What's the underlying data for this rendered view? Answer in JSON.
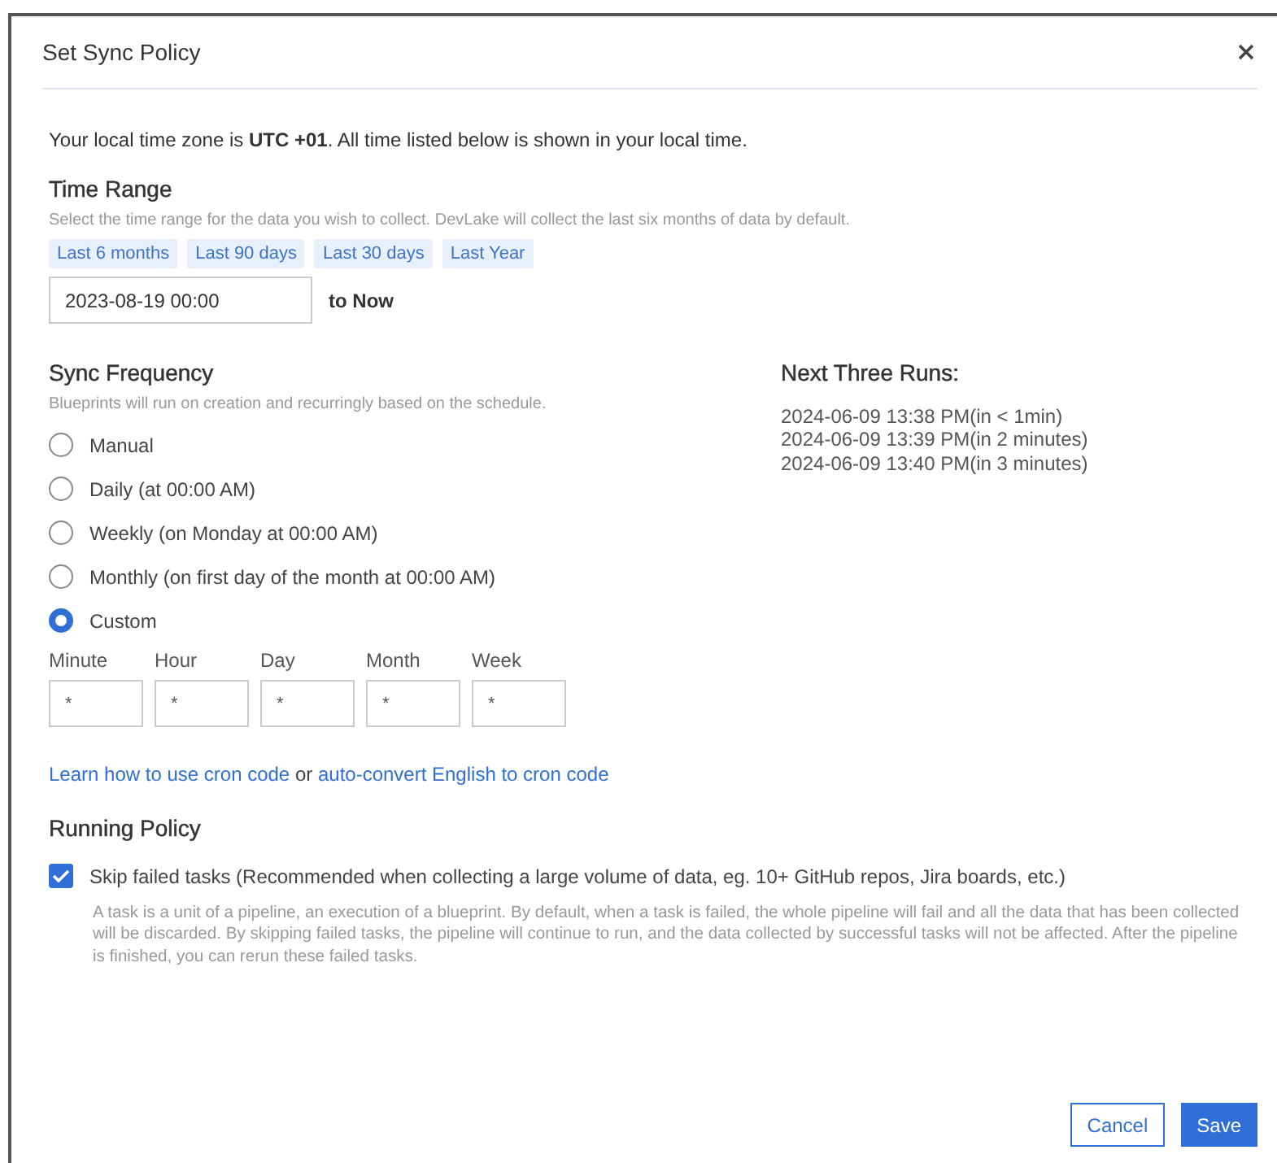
{
  "dialog": {
    "title": "Set Sync Policy",
    "timezone_note": "Your local time zone is **UTC +01**. All time listed below is shown in your local time.",
    "time_range": {
      "heading": "Time Range",
      "description": "Select the time range for the data you wish to collect. DevLake will collect the last six months of data by default.",
      "presets": [
        {
          "label": "Last 6 months"
        },
        {
          "label": "Last 90 days"
        },
        {
          "label": "Last 30 days"
        },
        {
          "label": "Last Year"
        }
      ],
      "start_value": "2023-08-19 00:00",
      "suffix": "to Now"
    },
    "sync_frequency": {
      "heading": "Sync Frequency",
      "description": "Blueprints will run on creation and recurringly based on the schedule.",
      "options": [
        {
          "label": "Manual",
          "selected": false
        },
        {
          "label": "Daily (at 00:00 AM)",
          "selected": false
        },
        {
          "label": "Weekly (on Monday at 00:00 AM)",
          "selected": false
        },
        {
          "label": "Monthly (on first day of the month at 00:00 AM)",
          "selected": false
        },
        {
          "label": "Custom",
          "selected": true
        }
      ],
      "cron_fields": [
        {
          "label": "Minute",
          "value": "*"
        },
        {
          "label": "Hour",
          "value": "*"
        },
        {
          "label": "Day",
          "value": "*"
        },
        {
          "label": "Month",
          "value": "*"
        },
        {
          "label": "Week",
          "value": "*"
        }
      ],
      "help_link": "Learn how to use cron code",
      "help_joiner": "or",
      "convert_link": "auto-convert English to cron code"
    },
    "next_runs": {
      "heading": "Next Three Runs:",
      "runs": [
        "2024-06-09 13:38 PM(in < 1min)",
        "2024-06-09 13:39 PM(in 2 minutes)",
        "2024-06-09 13:40 PM(in 3 minutes)"
      ]
    },
    "running_policy": {
      "heading": "Running Policy",
      "skip_failed": {
        "label": "Skip failed tasks (Recommended when collecting a large volume of data, eg. 10+ GitHub repos, Jira boards, etc.)",
        "checked": true
      },
      "description": "A task is a unit of a pipeline, an execution of a blueprint. By default, when a task is failed, the whole pipeline will fail and all the data that has been collected will be discarded. By skipping failed tasks, the pipeline will continue to run, and the data collected by successful tasks will not be affected. After the pipeline is finished, you can rerun these failed tasks."
    },
    "buttons": [
      {
        "label": "Cancel",
        "kind": "secondary"
      },
      {
        "label": "Save",
        "kind": "primary"
      }
    ]
  }
}
